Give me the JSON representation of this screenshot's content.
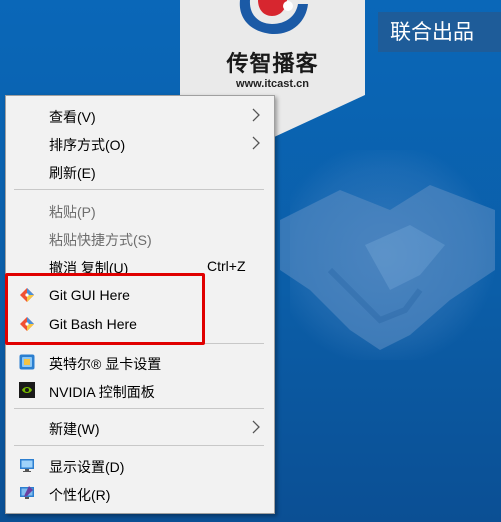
{
  "logo": {
    "title": "传智播客",
    "url": "www.itcast.cn",
    "colors": {
      "card": "#eaeaea",
      "mark_blue": "#1b5aa6",
      "mark_red": "#d7262f"
    }
  },
  "banner": {
    "text": "联合出品"
  },
  "context_menu": {
    "items": {
      "view": {
        "label": "查看(V)",
        "has_submenu": true
      },
      "sort": {
        "label": "排序方式(O)",
        "has_submenu": true
      },
      "refresh": {
        "label": "刷新(E)"
      },
      "paste": {
        "label": "粘贴(P)",
        "disabled": true
      },
      "paste_shortcut": {
        "label": "粘贴快捷方式(S)",
        "disabled": true
      },
      "undo": {
        "label": "撤消 复制(U)",
        "shortcut": "Ctrl+Z"
      },
      "git_gui": {
        "label": "Git GUI Here",
        "icon": "git-icon"
      },
      "git_bash": {
        "label": "Git Bash Here",
        "icon": "git-icon"
      },
      "intel": {
        "label": "英特尔® 显卡设置",
        "icon": "intel-graphics-icon"
      },
      "nvidia": {
        "label": "NVIDIA 控制面板",
        "icon": "nvidia-icon"
      },
      "new": {
        "label": "新建(W)",
        "has_submenu": true
      },
      "display": {
        "label": "显示设置(D)",
        "icon": "display-settings-icon"
      },
      "personalize": {
        "label": "个性化(R)",
        "icon": "personalize-icon"
      }
    }
  },
  "colors": {
    "desktop_blue": "#0b5ea8",
    "menu_bg": "#f2f2f2",
    "highlight_red": "#e00000",
    "disabled_text": "#6d6d6d"
  }
}
